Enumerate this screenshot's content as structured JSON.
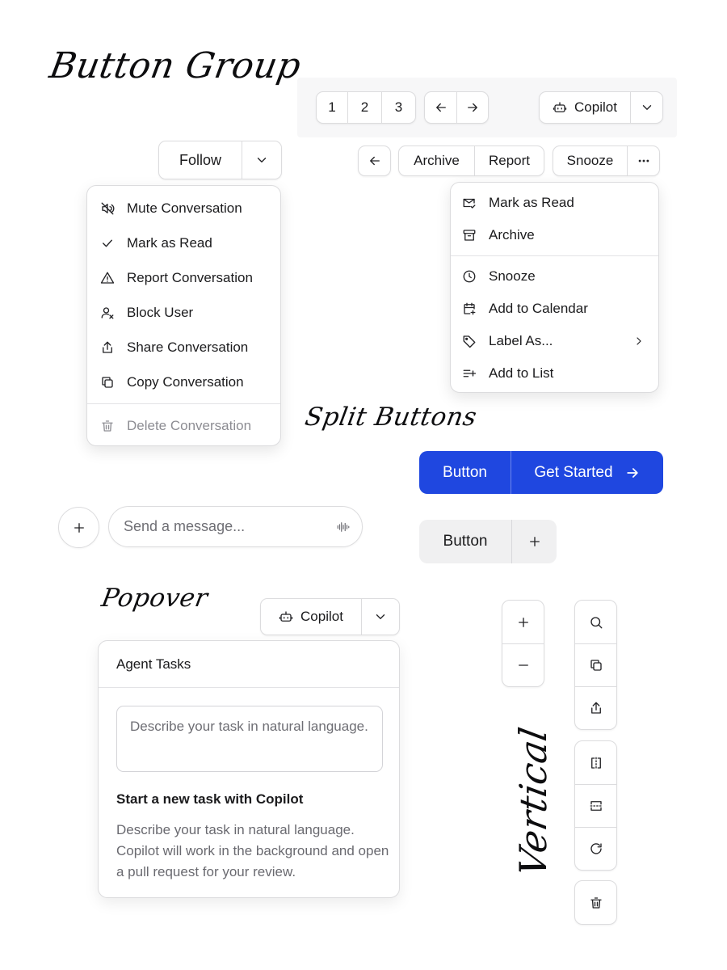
{
  "headings": {
    "button_group": "Button Group",
    "split_buttons": "Split Buttons",
    "popover": "Popover",
    "vertical": "Vertical"
  },
  "pagination": {
    "pages": [
      "1",
      "2",
      "3"
    ]
  },
  "copilot_top": {
    "label": "Copilot"
  },
  "follow": {
    "label": "Follow"
  },
  "mail_toolbar": {
    "archive": "Archive",
    "report": "Report",
    "snooze": "Snooze"
  },
  "conversation_menu": {
    "items": [
      {
        "label": "Mute Conversation",
        "icon": "mute-icon"
      },
      {
        "label": "Mark as Read",
        "icon": "check-icon"
      },
      {
        "label": "Report Conversation",
        "icon": "warning-icon"
      },
      {
        "label": "Block User",
        "icon": "block-user-icon"
      },
      {
        "label": "Share Conversation",
        "icon": "share-icon"
      },
      {
        "label": "Copy Conversation",
        "icon": "copy-icon"
      }
    ],
    "danger_item": {
      "label": "Delete Conversation",
      "icon": "trash-icon",
      "disabled": true
    }
  },
  "mail_menu": {
    "group1": [
      {
        "label": "Mark as Read",
        "icon": "mail-check-icon"
      },
      {
        "label": "Archive",
        "icon": "archive-icon"
      }
    ],
    "group2": [
      {
        "label": "Snooze",
        "icon": "clock-icon"
      },
      {
        "label": "Add to Calendar",
        "icon": "calendar-plus-icon"
      },
      {
        "label": "Label As...",
        "icon": "tag-icon",
        "has_submenu": true
      },
      {
        "label": "Add to List",
        "icon": "list-plus-icon"
      }
    ]
  },
  "split_primary": {
    "left": "Button",
    "right": "Get Started",
    "color": "#1f47e0"
  },
  "split_secondary": {
    "left": "Button"
  },
  "message_input": {
    "placeholder": "Send a message..."
  },
  "copilot_popover_trigger": {
    "label": "Copilot"
  },
  "popover": {
    "title": "Agent Tasks",
    "textarea_placeholder": "Describe your task in natural language.",
    "heading": "Start a new task with Copilot",
    "description": "Describe your task in natural language. Copilot will work in the background and open a pull request for your review."
  },
  "vertical_groups": {
    "zoom": [
      "plus-icon",
      "minus-icon"
    ],
    "actions": [
      "search-icon",
      "copy-icon",
      "share-icon"
    ],
    "layout": [
      "split-vertical-icon",
      "split-horizontal-icon",
      "refresh-icon"
    ],
    "danger": [
      "trash-icon"
    ]
  }
}
